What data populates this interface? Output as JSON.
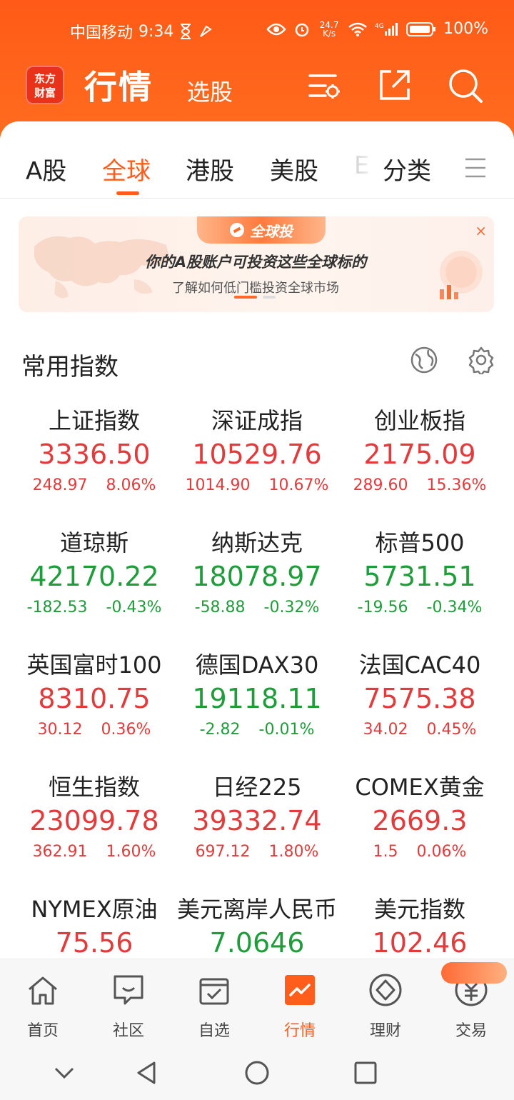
{
  "status_bar": {
    "carrier": "中国移动",
    "time": "9:34",
    "net_speed": "24.7",
    "net_unit": "K/s",
    "signal": "4G",
    "battery": "100%"
  },
  "header": {
    "logo_text": "东方\n财富",
    "title": "行情",
    "subtitle": "选股",
    "icons": [
      "filter-settings-icon",
      "share-icon",
      "search-icon"
    ]
  },
  "tabs": [
    {
      "label": "A股",
      "active": false
    },
    {
      "label": "全球",
      "active": true
    },
    {
      "label": "港股",
      "active": false
    },
    {
      "label": "美股",
      "active": false
    },
    {
      "label": "E",
      "active": false
    },
    {
      "label": "分类",
      "active": false
    }
  ],
  "banner": {
    "tag": "全球投",
    "headline": "你的A股账户可投资这些全球标的",
    "subline": "了解如何低门槛投资全球市场",
    "close": "×"
  },
  "section": {
    "title": "常用指数",
    "icons": [
      "globe-icon",
      "settings-icon"
    ]
  },
  "indices": [
    {
      "name": "上证指数",
      "price": "3336.50",
      "change": "248.97",
      "pct": "8.06%",
      "dir": "up"
    },
    {
      "name": "深证成指",
      "price": "10529.76",
      "change": "1014.90",
      "pct": "10.67%",
      "dir": "up"
    },
    {
      "name": "创业板指",
      "price": "2175.09",
      "change": "289.60",
      "pct": "15.36%",
      "dir": "up"
    },
    {
      "name": "道琼斯",
      "price": "42170.22",
      "change": "-182.53",
      "pct": "-0.43%",
      "dir": "down"
    },
    {
      "name": "纳斯达克",
      "price": "18078.97",
      "change": "-58.88",
      "pct": "-0.32%",
      "dir": "down"
    },
    {
      "name": "标普500",
      "price": "5731.51",
      "change": "-19.56",
      "pct": "-0.34%",
      "dir": "down"
    },
    {
      "name": "英国富时100",
      "price": "8310.75",
      "change": "30.12",
      "pct": "0.36%",
      "dir": "up"
    },
    {
      "name": "德国DAX30",
      "price": "19118.11",
      "change": "-2.82",
      "pct": "-0.01%",
      "dir": "down"
    },
    {
      "name": "法国CAC40",
      "price": "7575.38",
      "change": "34.02",
      "pct": "0.45%",
      "dir": "up"
    },
    {
      "name": "恒生指数",
      "price": "23099.78",
      "change": "362.91",
      "pct": "1.60%",
      "dir": "up"
    },
    {
      "name": "日经225",
      "price": "39332.74",
      "change": "697.12",
      "pct": "1.80%",
      "dir": "up"
    },
    {
      "name": "COMEX黄金",
      "price": "2669.3",
      "change": "1.5",
      "pct": "0.06%",
      "dir": "up"
    },
    {
      "name": "NYMEX原油",
      "price": "75.56",
      "change": "",
      "pct": "",
      "dir": "up"
    },
    {
      "name": "美元离岸人民币",
      "price": "7.0646",
      "change": "",
      "pct": "",
      "dir": "down"
    },
    {
      "name": "美元指数",
      "price": "102.46",
      "change": "",
      "pct": "",
      "dir": "up"
    }
  ],
  "bottom_nav": [
    {
      "label": "首页",
      "icon": "home-icon",
      "active": false
    },
    {
      "label": "社区",
      "icon": "chat-icon",
      "active": false
    },
    {
      "label": "自选",
      "icon": "watchlist-icon",
      "active": false
    },
    {
      "label": "行情",
      "icon": "market-chart-icon",
      "active": true
    },
    {
      "label": "理财",
      "icon": "wealth-icon",
      "active": false
    },
    {
      "label": "交易",
      "icon": "trade-icon",
      "active": false
    }
  ],
  "colors": {
    "brand": "#ff5d1c",
    "up": "#e33b3b",
    "down": "#1f9d3a"
  }
}
